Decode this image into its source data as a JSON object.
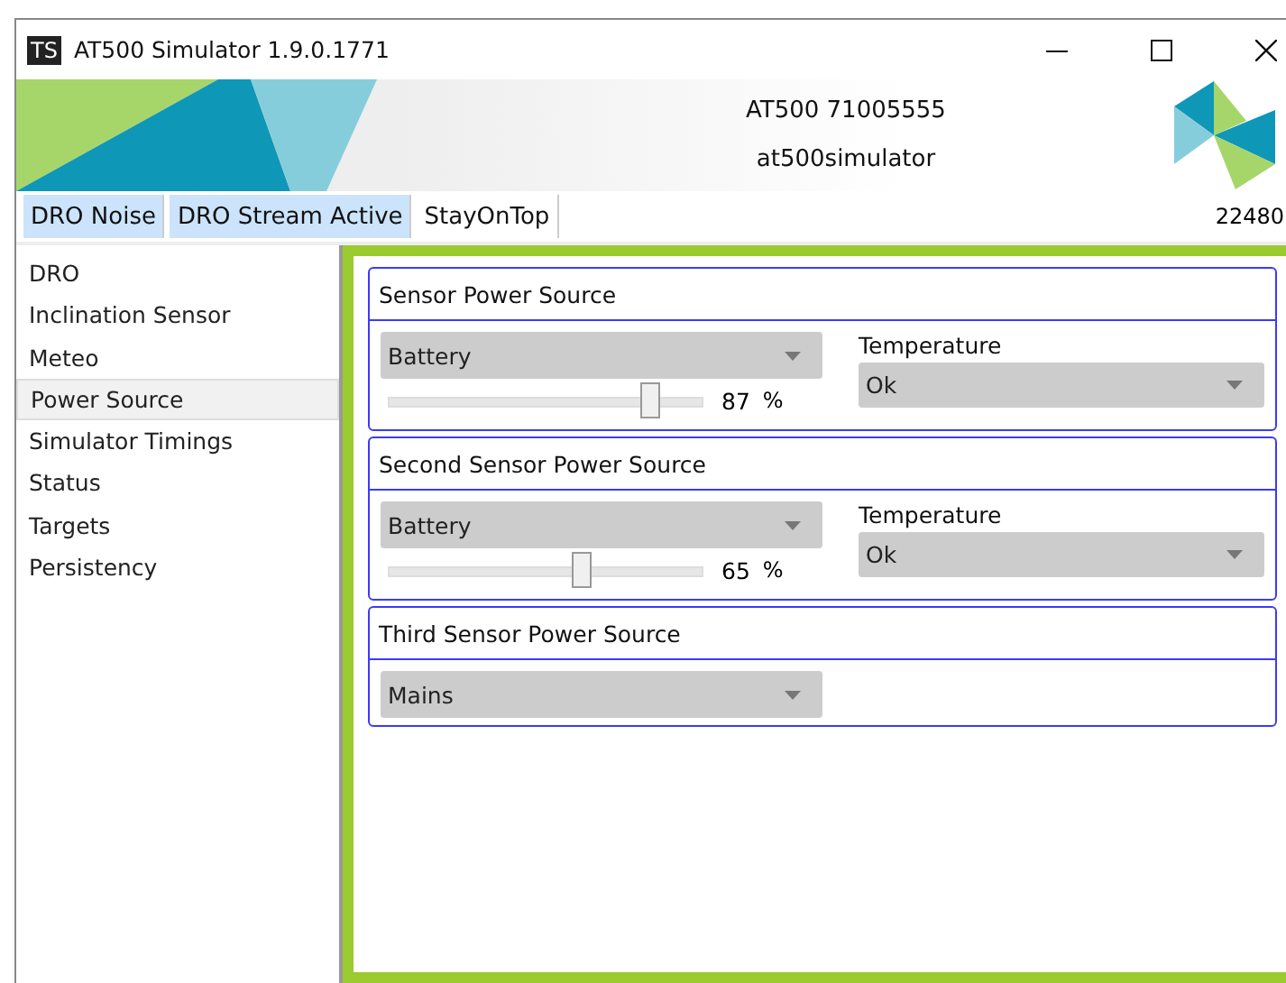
{
  "window": {
    "title": "AT500 Simulator 1.9.0.1771",
    "icon_text": "TS"
  },
  "banner": {
    "device": "AT500 71005555",
    "host": "at500simulator"
  },
  "toolbar": {
    "toggles": [
      {
        "label": "DRO Noise",
        "selected": true
      },
      {
        "label": "DRO Stream Active",
        "selected": true
      },
      {
        "label": "StayOnTop",
        "selected": false
      }
    ],
    "counter": "22480"
  },
  "sidebar": {
    "items": [
      {
        "label": "DRO",
        "selected": false
      },
      {
        "label": "Inclination Sensor",
        "selected": false
      },
      {
        "label": "Meteo",
        "selected": false
      },
      {
        "label": "Power Source",
        "selected": true
      },
      {
        "label": "Simulator Timings",
        "selected": false
      },
      {
        "label": "Status",
        "selected": false
      },
      {
        "label": "Targets",
        "selected": false
      },
      {
        "label": "Persistency",
        "selected": false
      }
    ]
  },
  "panels": [
    {
      "title": "Sensor Power Source",
      "source": "Battery",
      "level": 0.87,
      "reading": "87",
      "unit": "%",
      "temperature_label": "Temperature",
      "temperature": "Ok"
    },
    {
      "title": "Second Sensor Power Source",
      "source": "Battery",
      "level": 0.65,
      "reading": "65",
      "unit": "%",
      "temperature_label": "Temperature",
      "temperature": "Ok"
    },
    {
      "title": "Third Sensor Power Source",
      "source": "Mains"
    }
  ]
}
